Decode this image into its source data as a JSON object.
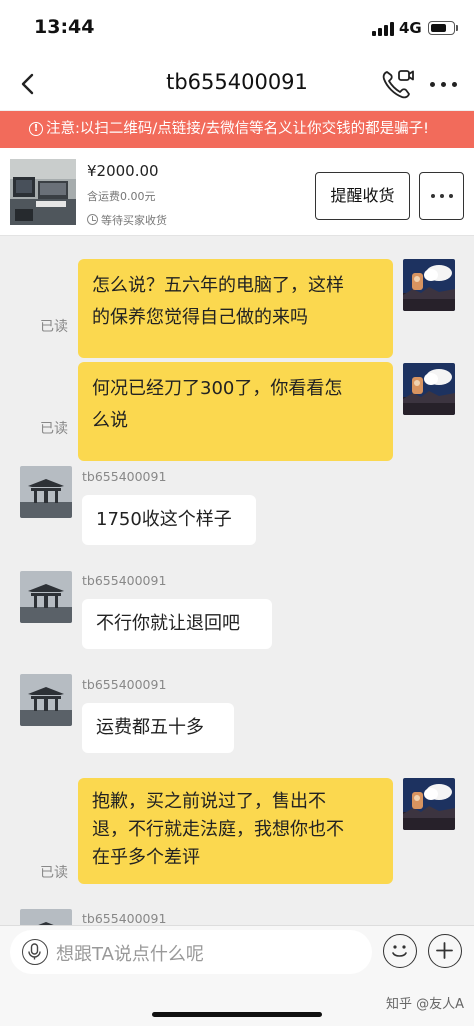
{
  "status_bar": {
    "time": "13:44",
    "network": "4G"
  },
  "header": {
    "title": "tb655400091"
  },
  "warning": {
    "icon": "!",
    "text": "注意:以扫二维码/点链接/去微信等名义让你交钱的都是骗子!"
  },
  "order": {
    "price": "¥2000.00",
    "shipping": "含运费0.00元",
    "status": "等待买家收货",
    "remind_label": "提醒收货"
  },
  "messages": [
    {
      "side": "me",
      "lines": [
        "怎么说？五六年的电脑了，这样",
        "的保养您觉得自己做的来吗"
      ],
      "read": "已读"
    },
    {
      "side": "me",
      "lines": [
        "何况已经刀了300了，你看看怎",
        "么说"
      ],
      "read": "已读"
    },
    {
      "side": "other",
      "sender": "tb655400091",
      "lines": [
        "1750收这个样子"
      ]
    },
    {
      "side": "other",
      "sender": "tb655400091",
      "lines": [
        "不行你就让退回吧"
      ]
    },
    {
      "side": "other",
      "sender": "tb655400091",
      "lines": [
        "运费都五十多"
      ]
    },
    {
      "side": "me",
      "lines": [
        "抱歉，买之前说过了，售出不",
        "退，不行就走法庭，我想你也不",
        "在乎多个差评"
      ],
      "read": "已读"
    },
    {
      "side": "other",
      "sender": "tb655400091",
      "lines": []
    }
  ],
  "input": {
    "placeholder": "想跟TA说点什么呢"
  },
  "watermark": "知乎 @友人A",
  "colors": {
    "warning_bg": "#f26b5b",
    "my_bubble": "#fbd84f",
    "other_bubble": "#ffffff"
  }
}
